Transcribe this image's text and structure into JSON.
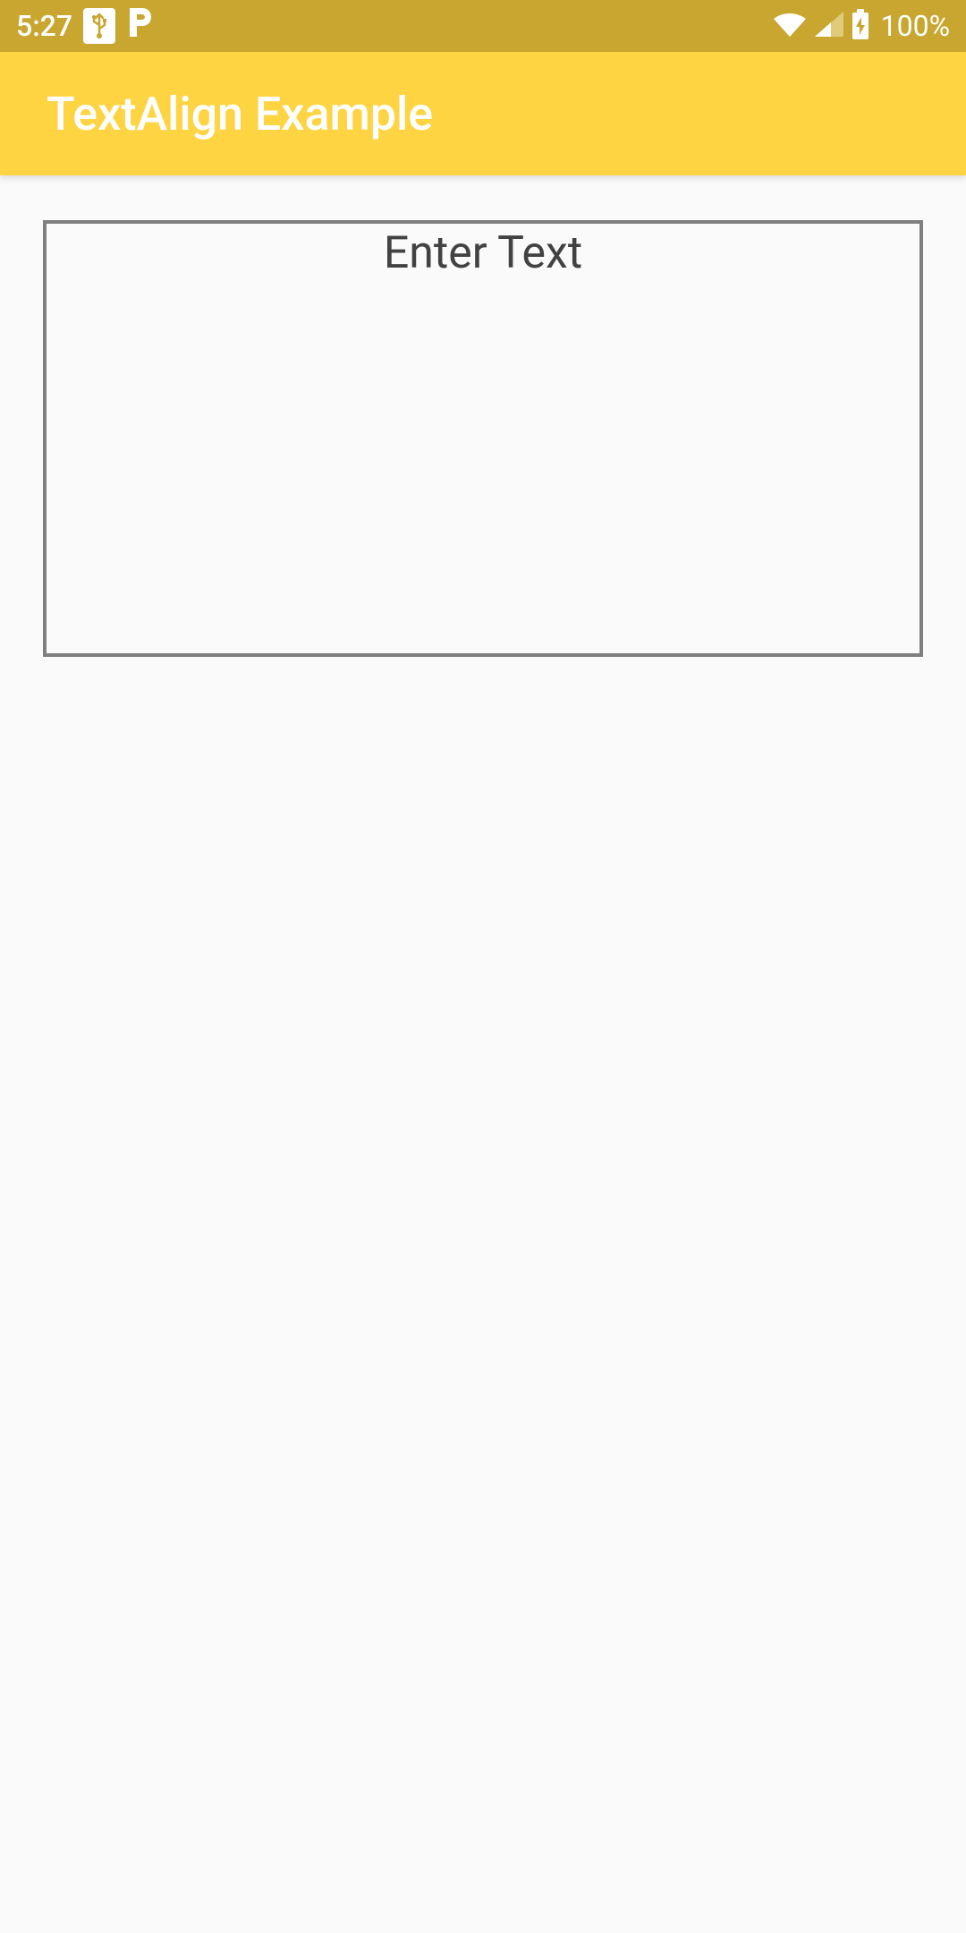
{
  "status_bar": {
    "time": "5:27",
    "battery_percent": "100%"
  },
  "app_bar": {
    "title": "TextAlign Example"
  },
  "input": {
    "placeholder": "Enter Text",
    "value": ""
  }
}
